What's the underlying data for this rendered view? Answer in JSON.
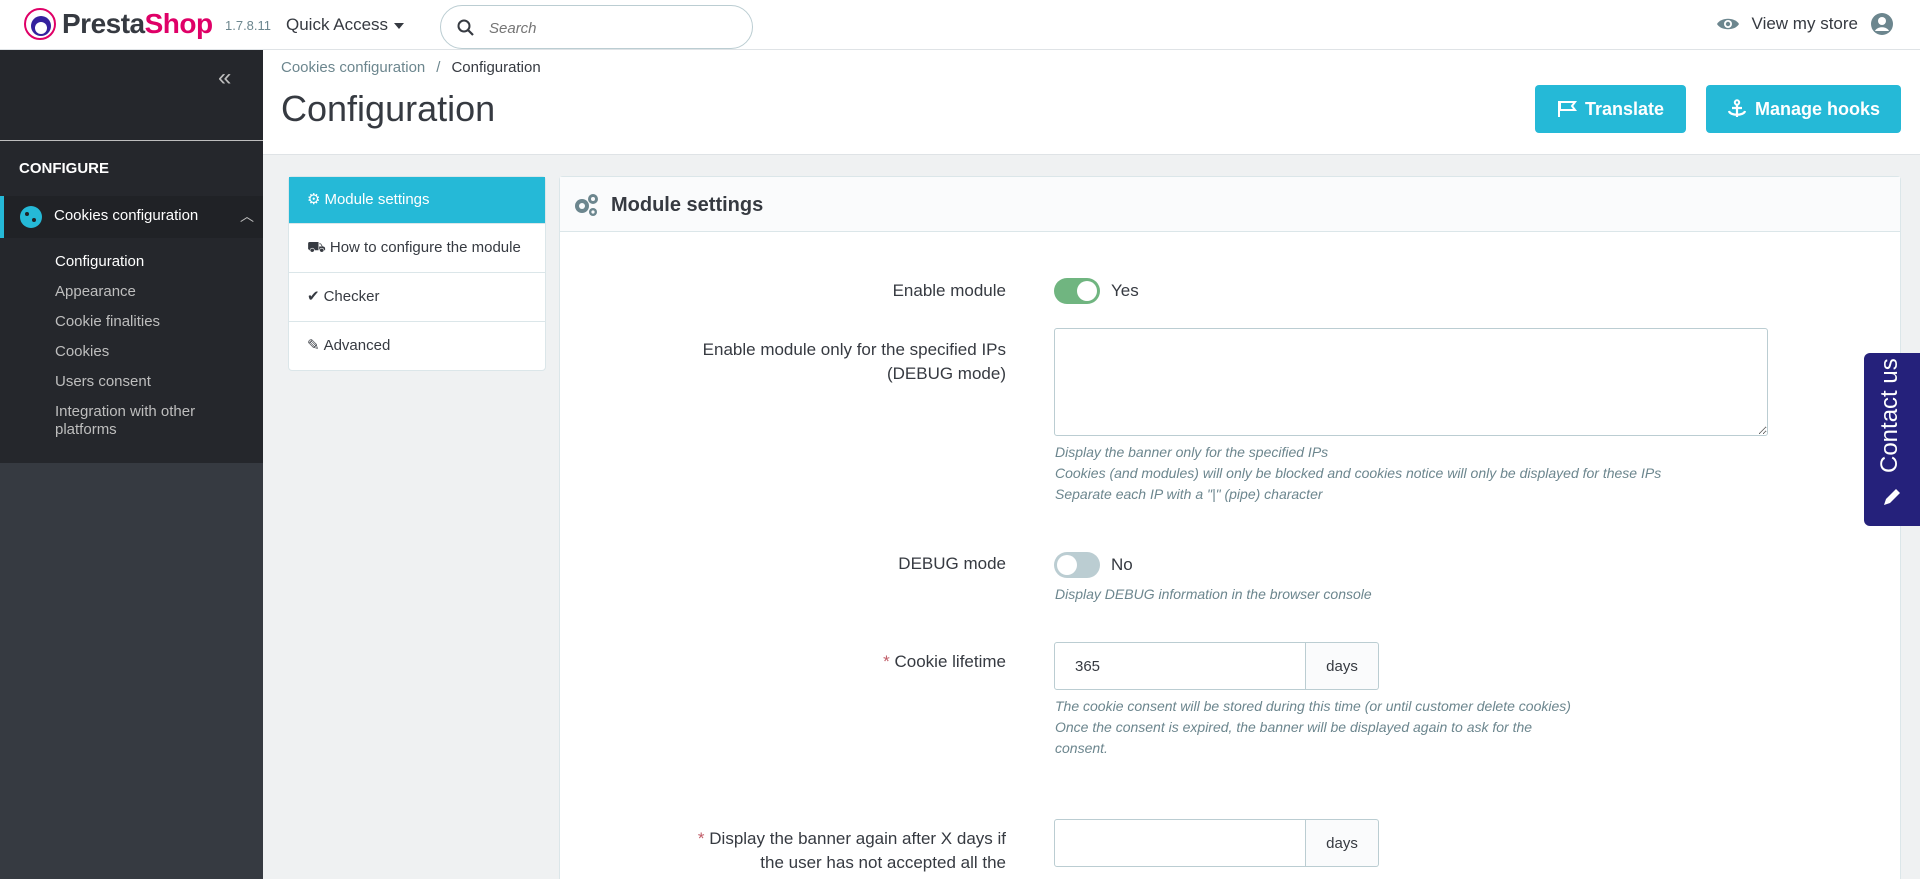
{
  "header": {
    "logo": {
      "part1": "Presta",
      "part2": "Shop"
    },
    "version": "1.7.8.11",
    "quick_access": "Quick Access",
    "search_placeholder": "Search",
    "view_store": "View my store"
  },
  "sidebar": {
    "section": "CONFIGURE",
    "active_item": "Cookies configuration",
    "submenu": [
      {
        "label": "Configuration",
        "current": true
      },
      {
        "label": "Appearance"
      },
      {
        "label": "Cookie finalities"
      },
      {
        "label": "Cookies"
      },
      {
        "label": "Users consent"
      },
      {
        "label": "Integration with other platforms"
      }
    ]
  },
  "page": {
    "breadcrumb": [
      "Cookies configuration",
      "Configuration"
    ],
    "title": "Configuration",
    "buttons": {
      "translate": "Translate",
      "manage_hooks": "Manage hooks"
    }
  },
  "tabs": [
    {
      "label": "Module settings",
      "icon": "cogs-icon",
      "active": true
    },
    {
      "label": "How to configure the module",
      "icon": "truck-icon"
    },
    {
      "label": "Checker",
      "icon": "check-icon"
    },
    {
      "label": "Advanced",
      "icon": "magic-icon"
    }
  ],
  "panel": {
    "title": "Module settings",
    "enable_module": {
      "label": "Enable module",
      "value": "Yes"
    },
    "debug_ips": {
      "label": "Enable module only for the specified IPs (DEBUG mode)",
      "value": "",
      "help": [
        "Display the banner only for the specified IPs",
        "Cookies (and modules) will only be blocked and cookies notice will only be displayed for these IPs",
        "Separate each IP with a \"|\" (pipe) character"
      ]
    },
    "debug_mode": {
      "label": "DEBUG mode",
      "value": "No",
      "help": "Display DEBUG information in the browser console"
    },
    "cookie_lifetime": {
      "label": "Cookie lifetime",
      "value": "365",
      "addon": "days",
      "help": [
        "The cookie consent will be stored during this time (or until customer delete cookies)",
        "Once the consent is expired, the banner will be displayed again to ask for the consent."
      ]
    },
    "display_again": {
      "label": "Display the banner again after X days if the user has not accepted all the",
      "value": "",
      "addon": "days"
    }
  },
  "contact_tab": "Contact us",
  "colors": {
    "accent": "#25b9d7",
    "switch_on": "#70b580",
    "brand": "#df0067",
    "contact": "#25217b"
  }
}
